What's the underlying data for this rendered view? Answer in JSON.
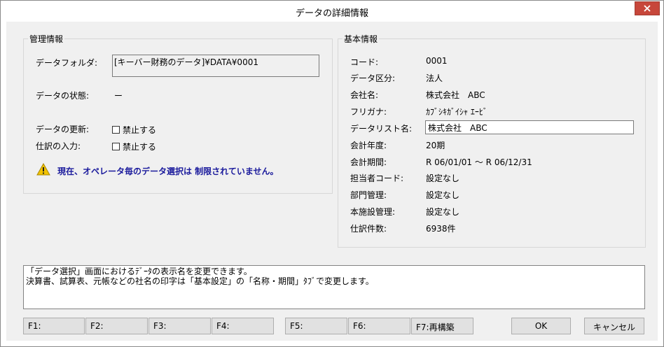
{
  "window": {
    "title": "データの詳細情報"
  },
  "management": {
    "group_title": "管理情報",
    "folder_label": "データフォルダ:",
    "folder_value": "[キーバー財務のデータ]¥DATA¥0001",
    "state_label": "データの状態:",
    "state_value": "ー",
    "update_label": "データの更新:",
    "update_checkbox_label": "禁止する",
    "entry_label": "仕訳の入力:",
    "entry_checkbox_label": "禁止する",
    "warning": "現在、オペレータ毎のデータ選択は 制限されていません。"
  },
  "basic": {
    "group_title": "基本情報",
    "code_label": "コード:",
    "code_value": "0001",
    "category_label": "データ区分:",
    "category_value": "法人",
    "company_label": "会社名:",
    "company_value": "株式会社　ABC",
    "furigana_label": "フリガナ:",
    "furigana_value": "ｶﾌﾞｼｷｶﾞｲｼｬ ｴｰﾋﾞ",
    "list_name_label": "データリスト名:",
    "list_name_value": "株式会社　ABC",
    "fiscal_year_label": "会計年度:",
    "fiscal_year_value": "20期",
    "period_label": "会計期間:",
    "period_value": "R 06/01/01 ～ R 06/12/31",
    "staff_code_label": "担当者コード:",
    "staff_code_value": "設定なし",
    "dept_label": "部門管理:",
    "dept_value": "設定なし",
    "branch_label": "本施設管理:",
    "branch_value": "設定なし",
    "entries_label": "仕訳件数:",
    "entries_value": "6938件"
  },
  "message": {
    "line1": "「データ選択」画面におけるﾃﾞｰﾀの表示名を変更できます。",
    "line2": "決算書、試算表、元帳などの社名の印字は「基本設定」の「名称・期間」ﾀﾌﾞで変更します。"
  },
  "buttons": {
    "f1": "F1:",
    "f2": "F2:",
    "f3": "F3:",
    "f4": "F4:",
    "f5": "F5:",
    "f6": "F6:",
    "f7": "F7:再構築",
    "ok": "OK",
    "cancel": "キャンセル"
  }
}
